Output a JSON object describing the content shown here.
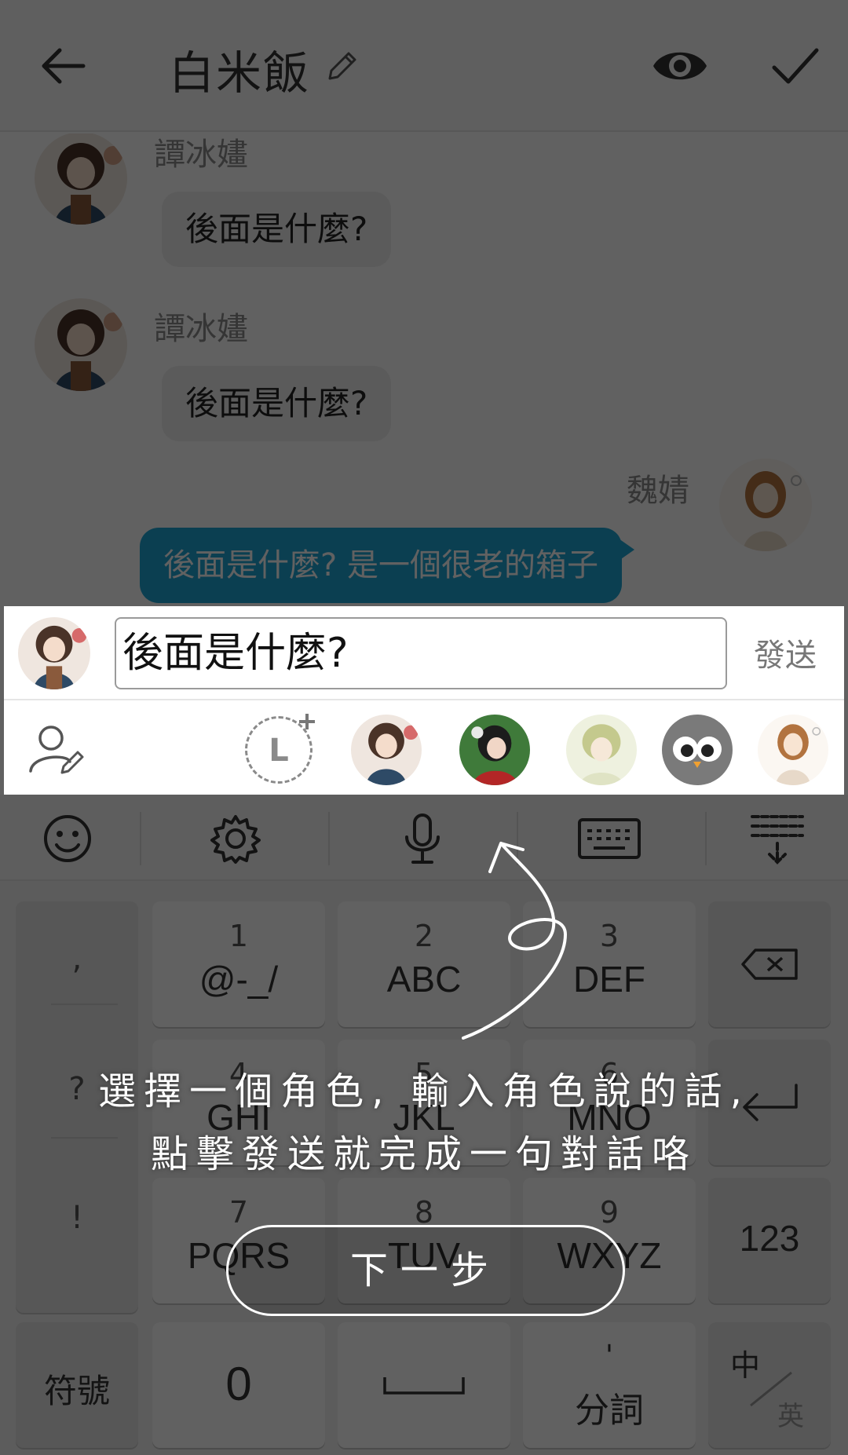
{
  "header": {
    "title": "白米飯"
  },
  "chat": {
    "messages": [
      {
        "sender": "譚冰嫿",
        "text": "後面是什麼?",
        "side": "left"
      },
      {
        "sender": "譚冰嫿",
        "text": "後面是什麼?",
        "side": "left"
      },
      {
        "sender": "魏婧",
        "text": "後面是什麼? 是一個很老的箱子",
        "side": "right"
      }
    ]
  },
  "composer": {
    "input_value": "後面是什麼?",
    "send_label": "發送",
    "add_character_letter": "L"
  },
  "keyboard": {
    "side_keys": [
      ",",
      "?",
      "!"
    ],
    "keys": [
      {
        "num": "1",
        "letters": "@-_/"
      },
      {
        "num": "2",
        "letters": "ABC"
      },
      {
        "num": "3",
        "letters": "DEF"
      },
      {
        "num": "4",
        "letters": "GHI"
      },
      {
        "num": "5",
        "letters": "JKL"
      },
      {
        "num": "6",
        "letters": "MNO"
      },
      {
        "num": "7",
        "letters": "PQRS"
      },
      {
        "num": "8",
        "letters": "TUV"
      },
      {
        "num": "9",
        "letters": "WXYZ"
      }
    ],
    "num_mode_label": "123",
    "symbols_label": "符號",
    "zero_label": "0",
    "segment_top": "'",
    "segment_label": "分詞",
    "lang_top": "中",
    "lang_bottom": "英"
  },
  "tutorial": {
    "line1": "選擇一個角色, 輸入角色說的話,",
    "line2": "點擊發送就完成一句對話咯",
    "next_label": "下一步"
  },
  "colors": {
    "accent_bubble": "#1ea6d6"
  }
}
